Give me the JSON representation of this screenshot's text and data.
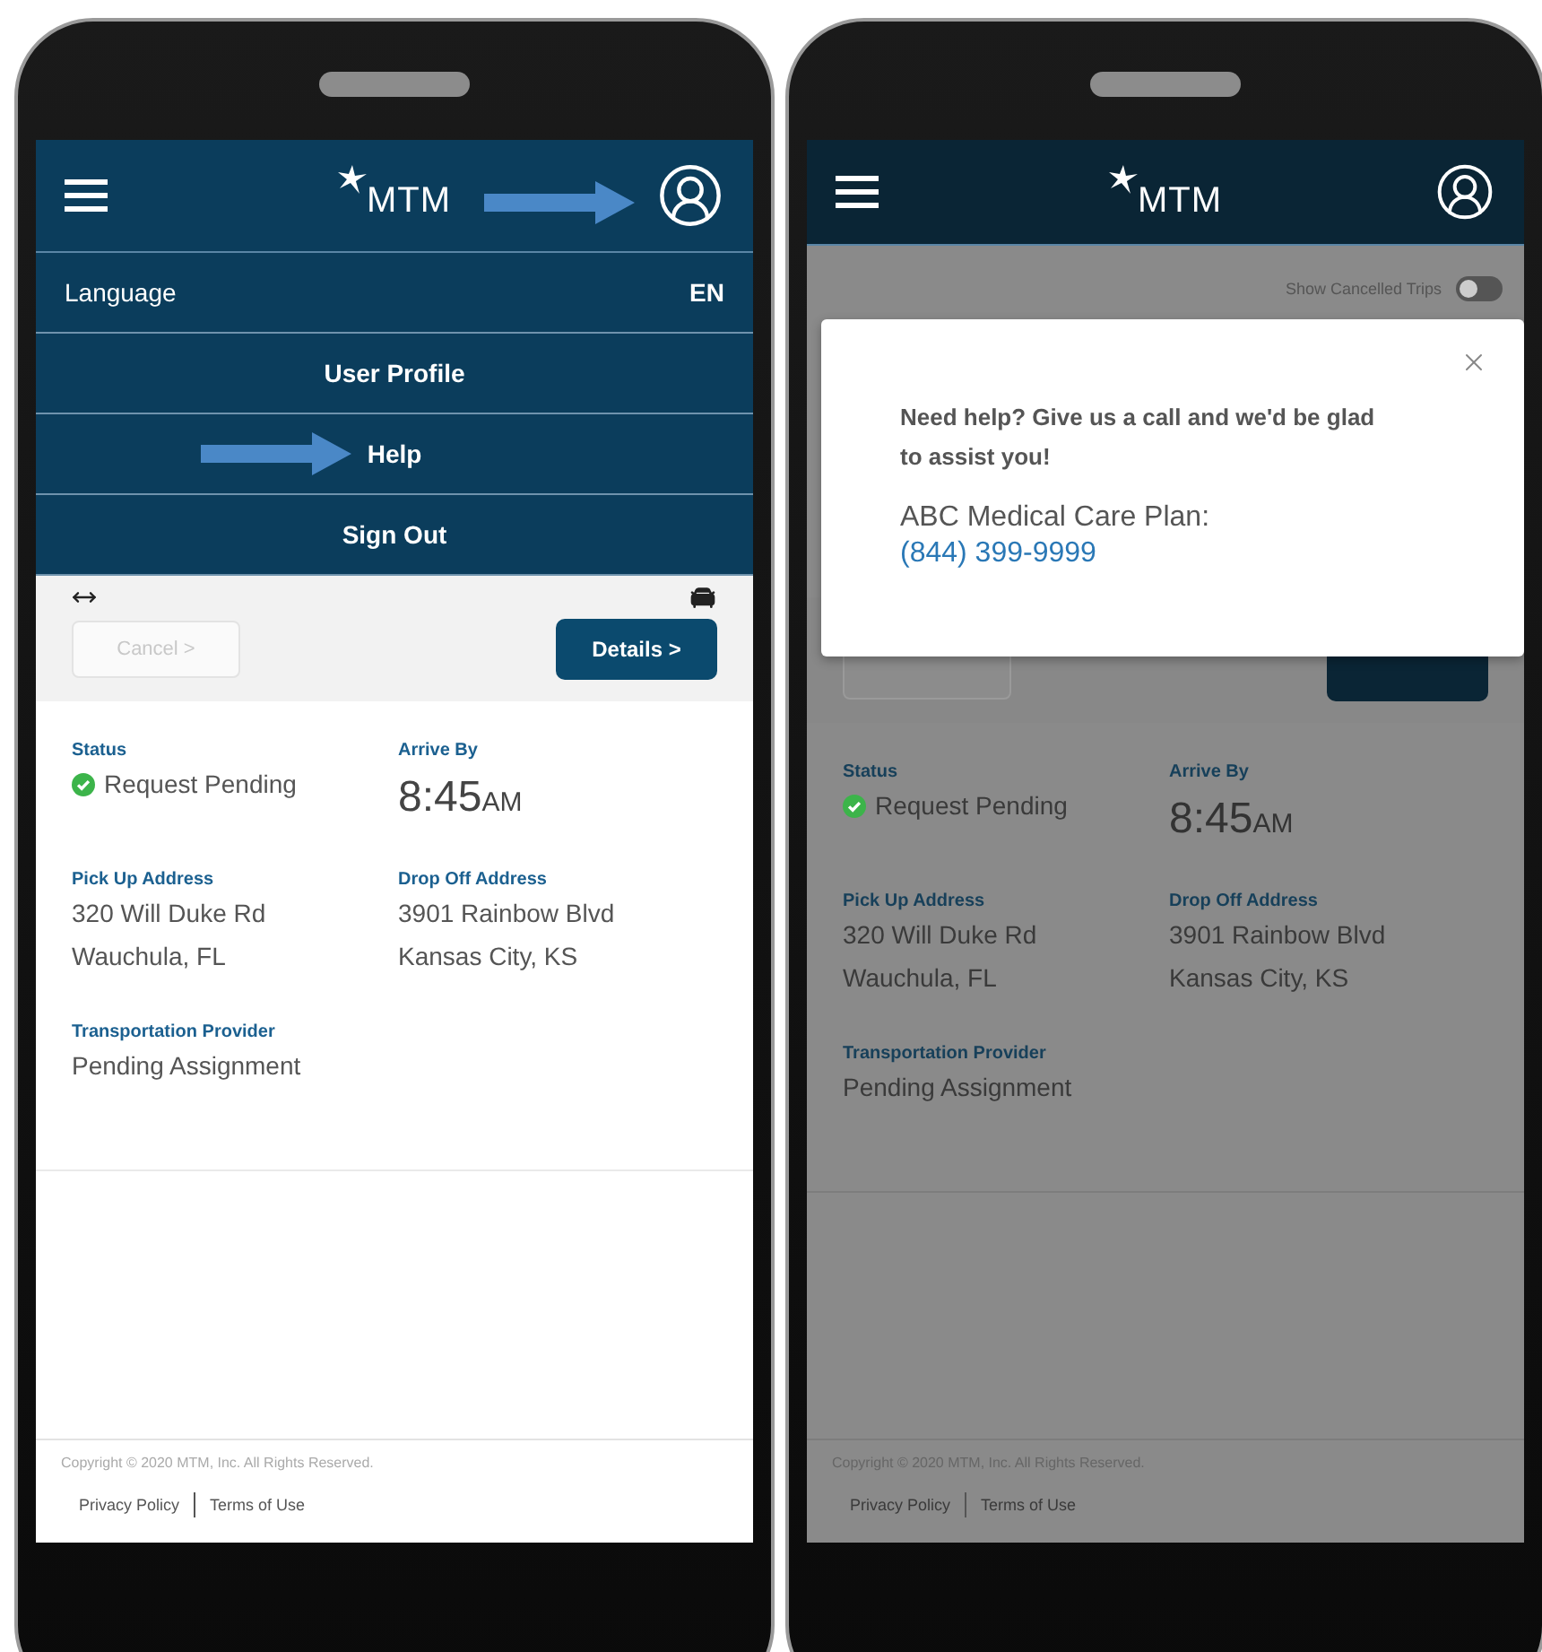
{
  "screens": [
    {
      "header": {
        "logo": "MTM",
        "profile_highlighted": true
      },
      "menu": {
        "language": {
          "label": "Language",
          "value": "EN"
        },
        "items": [
          {
            "label": "User Profile",
            "highlighted": false
          },
          {
            "label": "Help",
            "highlighted": true
          },
          {
            "label": "Sign Out",
            "highlighted": false
          }
        ]
      },
      "trip": {
        "buttons": [
          {
            "kind": "cancel",
            "label": "Cancel >",
            "disabled": true
          },
          {
            "kind": "details",
            "label": "Details >",
            "disabled": false
          }
        ],
        "fields": [
          {
            "kind": "status",
            "label": "Status",
            "lines": [
              "Request Pending"
            ]
          },
          {
            "kind": "time",
            "label": "Arrive By",
            "value": "8:45",
            "suffix": "AM"
          },
          {
            "kind": "text",
            "label": "Pick Up Address",
            "lines": [
              "320 Will Duke Rd",
              "Wauchula, FL"
            ]
          },
          {
            "kind": "text",
            "label": "Drop Off Address",
            "lines": [
              "3901 Rainbow Blvd",
              "Kansas City, KS"
            ]
          },
          {
            "kind": "text",
            "label": "Transportation Provider",
            "lines": [
              "Pending Assignment"
            ]
          }
        ]
      },
      "footer": {
        "copyright": "Copyright © 2020 MTM, Inc. All Rights Reserved.",
        "links": [
          "Privacy Policy",
          "Terms of Use"
        ]
      }
    },
    {
      "header": {
        "logo": "MTM",
        "profile_highlighted": false
      },
      "toggle": {
        "label": "Show Cancelled Trips",
        "on": false
      },
      "dialog": {
        "message": "Need help? Give us a call and we'd be glad to assist you!",
        "plan": "ABC Medical Care Plan:",
        "phone": "(844) 399-9999"
      },
      "trip": {
        "buttons": [
          {
            "kind": "cancel"
          },
          {
            "kind": "details"
          }
        ],
        "fields": [
          {
            "kind": "status",
            "label": "Status",
            "lines": [
              "Request Pending"
            ]
          },
          {
            "kind": "time",
            "label": "Arrive By",
            "value": "8:45",
            "suffix": "AM"
          },
          {
            "kind": "text",
            "label": "Pick Up Address",
            "lines": [
              "320 Will Duke Rd",
              "Wauchula, FL"
            ]
          },
          {
            "kind": "text",
            "label": "Drop Off Address",
            "lines": [
              "3901 Rainbow Blvd",
              "Kansas City, KS"
            ]
          },
          {
            "kind": "text",
            "label": "Transportation Provider",
            "lines": [
              "Pending Assignment"
            ]
          }
        ]
      },
      "footer": {
        "copyright": "Copyright © 2020 MTM, Inc. All Rights Reserved.",
        "links": [
          "Privacy Policy",
          "Terms of Use"
        ]
      }
    }
  ]
}
